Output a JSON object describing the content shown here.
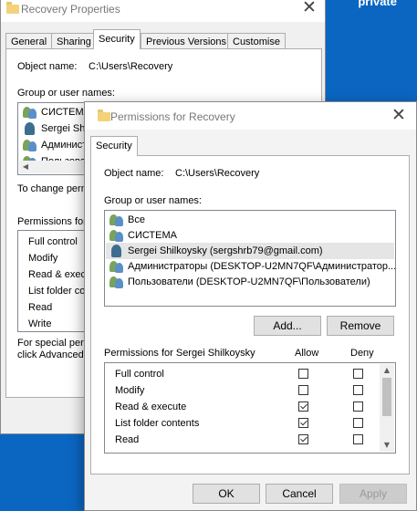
{
  "desktop": {
    "text": "private"
  },
  "background_window": {
    "title": "Recovery Properties",
    "tabs": [
      "General",
      "Sharing",
      "Security",
      "Previous Versions",
      "Customise"
    ],
    "object_name_label": "Object name:",
    "object_name_value": "C:\\Users\\Recovery",
    "group_label": "Group or user names:",
    "users": [
      "СИСТЕМА",
      "Sergei Shil",
      "Админист",
      "Пользоват"
    ],
    "change_text": "To change perm",
    "permissions_label": "Permissions for",
    "permissions": [
      "Full control",
      "Modify",
      "Read & execu",
      "List folder co",
      "Read",
      "Write"
    ],
    "special_text_1": "For special perm",
    "special_text_2": "click Advanced"
  },
  "dialog": {
    "title": "Permissions for Recovery",
    "tab": "Security",
    "object_name_label": "Object name:",
    "object_name_value": "C:\\Users\\Recovery",
    "group_label": "Group or user names:",
    "users": [
      {
        "name": "Все",
        "icon": "group-icon",
        "selected": false
      },
      {
        "name": "СИСТЕМА",
        "icon": "group-icon",
        "selected": false
      },
      {
        "name": "Sergei Shilkoysky (sergshrb79@gmail.com)",
        "icon": "user-icon",
        "selected": true
      },
      {
        "name": "Администраторы (DESKTOP-U2MN7QF\\Администратор...",
        "icon": "group-icon",
        "selected": false
      },
      {
        "name": "Пользователи (DESKTOP-U2MN7QF\\Пользователи)",
        "icon": "group-icon",
        "selected": false
      }
    ],
    "add_button": "Add...",
    "remove_button": "Remove",
    "permissions_label": "Permissions for Sergei Shilkoysky",
    "allow_header": "Allow",
    "deny_header": "Deny",
    "permissions": [
      {
        "name": "Full control",
        "allow": false,
        "deny": false
      },
      {
        "name": "Modify",
        "allow": false,
        "deny": false
      },
      {
        "name": "Read & execute",
        "allow": true,
        "deny": false
      },
      {
        "name": "List folder contents",
        "allow": true,
        "deny": false
      },
      {
        "name": "Read",
        "allow": true,
        "deny": false
      }
    ],
    "ok_button": "OK",
    "cancel_button": "Cancel",
    "apply_button": "Apply"
  }
}
